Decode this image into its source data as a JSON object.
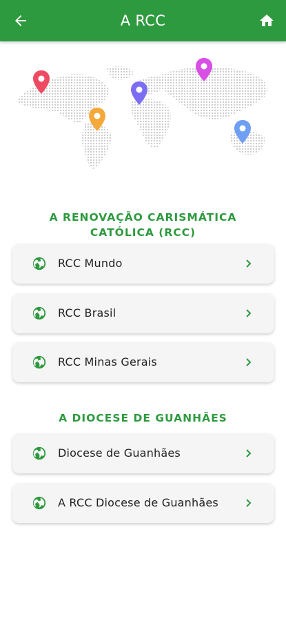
{
  "header": {
    "title": "A RCC",
    "back_icon": "arrow-left-icon",
    "home_icon": "home-icon"
  },
  "colors": {
    "primary": "#2e9a3f",
    "card_bg": "#f5f5f5",
    "pin_red": "#ee4b63",
    "pin_purple": "#d84fe6",
    "pin_blue": "#7c6ef2",
    "pin_orange": "#f5a93a",
    "pin_lightblue": "#6e9ff2"
  },
  "sections": [
    {
      "title": "A RENOVAÇÃO CARISMÁTICA CATÓLICA (RCC)",
      "title_line1": "A RENOVAÇÃO CARISMÁTICA",
      "title_line2": "CATÓLICA (RCC)",
      "items": [
        {
          "label": "RCC Mundo",
          "icon": "globe-icon"
        },
        {
          "label": "RCC Brasil",
          "icon": "globe-icon"
        },
        {
          "label": "RCC Minas Gerais",
          "icon": "globe-icon"
        }
      ]
    },
    {
      "title": "A DIOCESE DE GUANHÃES",
      "items": [
        {
          "label": "Diocese de Guanhães",
          "icon": "globe-icon"
        },
        {
          "label": "A RCC Diocese de Guanhães",
          "icon": "globe-icon"
        }
      ]
    }
  ]
}
